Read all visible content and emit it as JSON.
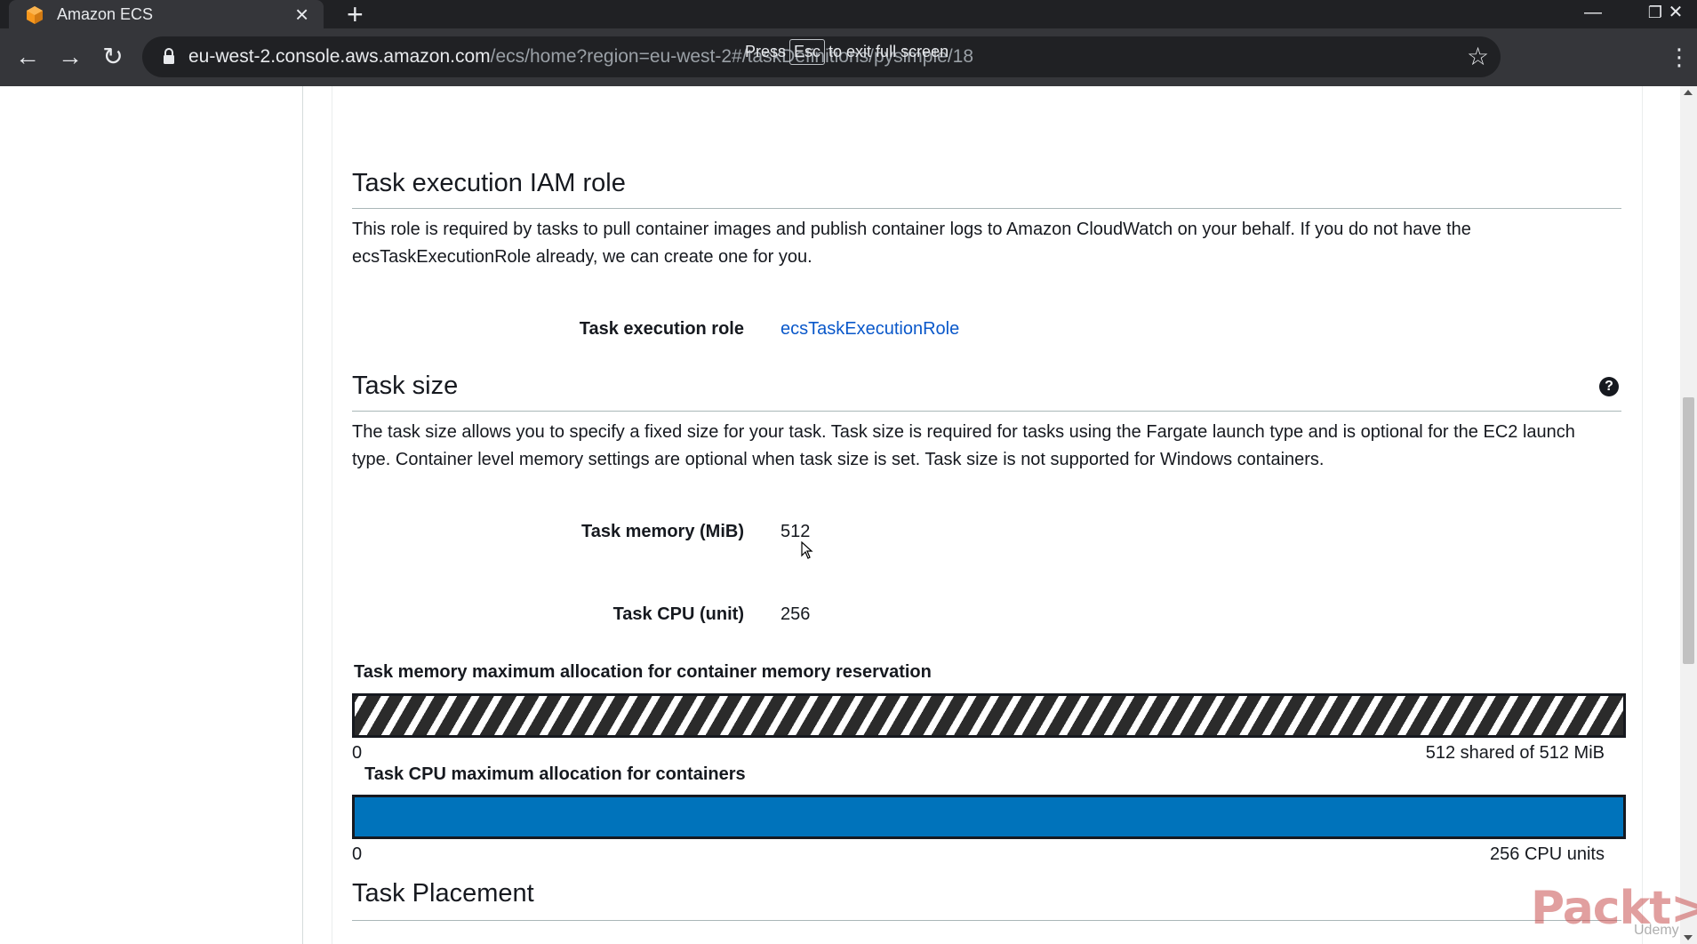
{
  "browser": {
    "tab_title": "Amazon ECS",
    "url_host": "eu-west-2.console.aws.amazon.com",
    "url_path": "/ecs/home?region=eu-west-2#/taskDefinitions/pysimple/18",
    "fullscreen_hint": {
      "before": "Press",
      "key": "Esc",
      "after": "to exit full screen"
    },
    "icons": {
      "favicon": "aws-ecs-icon",
      "lock": "lock-icon",
      "star": "star-icon"
    }
  },
  "execution_role": {
    "title": "Task execution IAM role",
    "description": "This role is required by tasks to pull container images and publish container logs to Amazon CloudWatch on your behalf. If you do not have the ecsTaskExecutionRole already, we can create one for you.",
    "role_label": "Task execution role",
    "role_value": "ecsTaskExecutionRole"
  },
  "task_size": {
    "title": "Task size",
    "help_icon": "?",
    "description": "The task size allows you to specify a fixed size for your task. Task size is required for tasks using the Fargate launch type and is optional for the EC2 launch type. Container level memory settings are optional when task size is set. Task size is not supported for Windows containers.",
    "memory_label": "Task memory (MiB)",
    "memory_value": "512",
    "cpu_label": "Task CPU (unit)",
    "cpu_value": "256"
  },
  "memory_allocation": {
    "title": "Task memory maximum allocation for container memory reservation",
    "min": "0",
    "max_label": "512 shared of 512 MiB",
    "fill_fraction": 1.0
  },
  "cpu_allocation": {
    "title": "Task CPU maximum allocation for containers",
    "min": "0",
    "max_label": "256 CPU units",
    "fill_fraction": 1.0
  },
  "task_placement": {
    "title": "Task Placement"
  },
  "watermark": {
    "brand": "Packt>",
    "sub": "Udemy"
  },
  "colors": {
    "link": "#0a58ca",
    "cpu_bar": "#0073bb",
    "chrome_dark": "#202124",
    "chrome_toolbar": "#35363a"
  }
}
